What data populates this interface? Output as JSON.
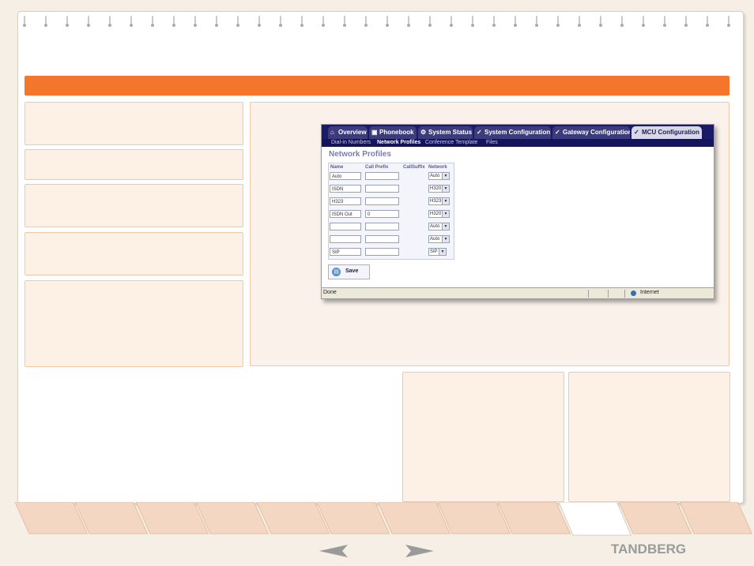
{
  "brand": {
    "logo_text": "TANDBERG",
    "accent_color": "#f3762c"
  },
  "screenshot": {
    "tabs": [
      {
        "label": "Overview",
        "icon": "home-icon",
        "active": false
      },
      {
        "label": "Phonebook",
        "icon": "phonebook-icon",
        "active": false
      },
      {
        "label": "System Status",
        "icon": "status-icon",
        "active": false
      },
      {
        "label": "System Configuration",
        "icon": "wrench-icon",
        "active": false
      },
      {
        "label": "Gateway Configuration",
        "icon": "wrench-icon",
        "active": false
      },
      {
        "label": "MCU Configuration",
        "icon": "wrench-icon",
        "active": true
      }
    ],
    "subtabs": [
      {
        "label": "Dial-in Numbers",
        "active": false
      },
      {
        "label": "Network Profiles",
        "active": true
      },
      {
        "label": "Conference Template",
        "active": false
      },
      {
        "label": "Files",
        "active": false
      }
    ],
    "heading": "Network Profiles",
    "columns": [
      "Name",
      "Call Prefix",
      "CallSuffix",
      "Network"
    ],
    "rows": [
      {
        "name": "Auto",
        "prefix": "",
        "network": "Auto"
      },
      {
        "name": "ISDN",
        "prefix": "",
        "network": "H320"
      },
      {
        "name": "H323",
        "prefix": "",
        "network": "H323"
      },
      {
        "name": "ISDN Out",
        "prefix": "0",
        "network": "H320"
      },
      {
        "name": "",
        "prefix": "",
        "network": "Auto"
      },
      {
        "name": "",
        "prefix": "",
        "network": "Auto"
      },
      {
        "name": "SIP",
        "prefix": "",
        "network": "SIP"
      }
    ],
    "save_label": "Save",
    "status": {
      "left": "Done",
      "zone": "Internet"
    }
  },
  "nav": {
    "tab_count": 12,
    "active_tab_index": 9,
    "prev_icon": "arrow-left-icon",
    "next_icon": "arrow-right-icon"
  }
}
